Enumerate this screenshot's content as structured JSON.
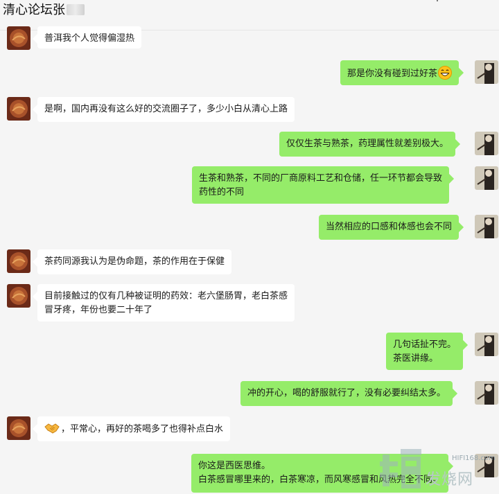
{
  "header": {
    "title": "清心论坛张"
  },
  "messages": [
    {
      "side": "left",
      "lines": [
        "普洱我个人觉得偏湿热"
      ]
    },
    {
      "side": "right",
      "lines": [
        "那是你没有碰到过好茶"
      ],
      "emoji": "grinning-face"
    },
    {
      "side": "left",
      "lines": [
        "是啊，国内再没有这么好的交流圈子了，多少小白从清心上路"
      ]
    },
    {
      "side": "right",
      "lines": [
        "仅仅生茶与熟茶，药理属性就差别极大。"
      ]
    },
    {
      "side": "right",
      "lines": [
        "生茶和熟茶，不同的厂商原料工艺和仓储，任一环节都会导致",
        "药性的不同"
      ]
    },
    {
      "side": "right",
      "lines": [
        "当然相应的口感和体感也会不同"
      ]
    },
    {
      "side": "left",
      "lines": [
        "茶药同源我认为是伪命题，茶的作用在于保健"
      ]
    },
    {
      "side": "left",
      "lines": [
        "目前接触过的仅有几种被证明的药效：老六堡肠胃，老白茶感",
        "冒牙疼，年份也要二十年了"
      ]
    },
    {
      "side": "right",
      "lines": [
        "几句话扯不完。",
        "茶医讲缘。"
      ]
    },
    {
      "side": "right",
      "lines": [
        "冲的开心，喝的舒服就行了，没有必要纠结太多。"
      ]
    },
    {
      "side": "left",
      "lines": [
        "，平常心，再好的茶喝多了也得补点白水"
      ],
      "emoji": "handshake"
    },
    {
      "side": "right",
      "lines": [
        "你这是西医思维。",
        "白茶感冒哪里来的，白茶寒凉，而风寒感冒和风热完全不同。"
      ]
    }
  ],
  "watermark": {
    "site": "HIFI168.com",
    "text": "发烧网"
  },
  "colors": {
    "background": "#f5f5f5",
    "bubble_left": "#ffffff",
    "bubble_right": "#95ec69"
  }
}
